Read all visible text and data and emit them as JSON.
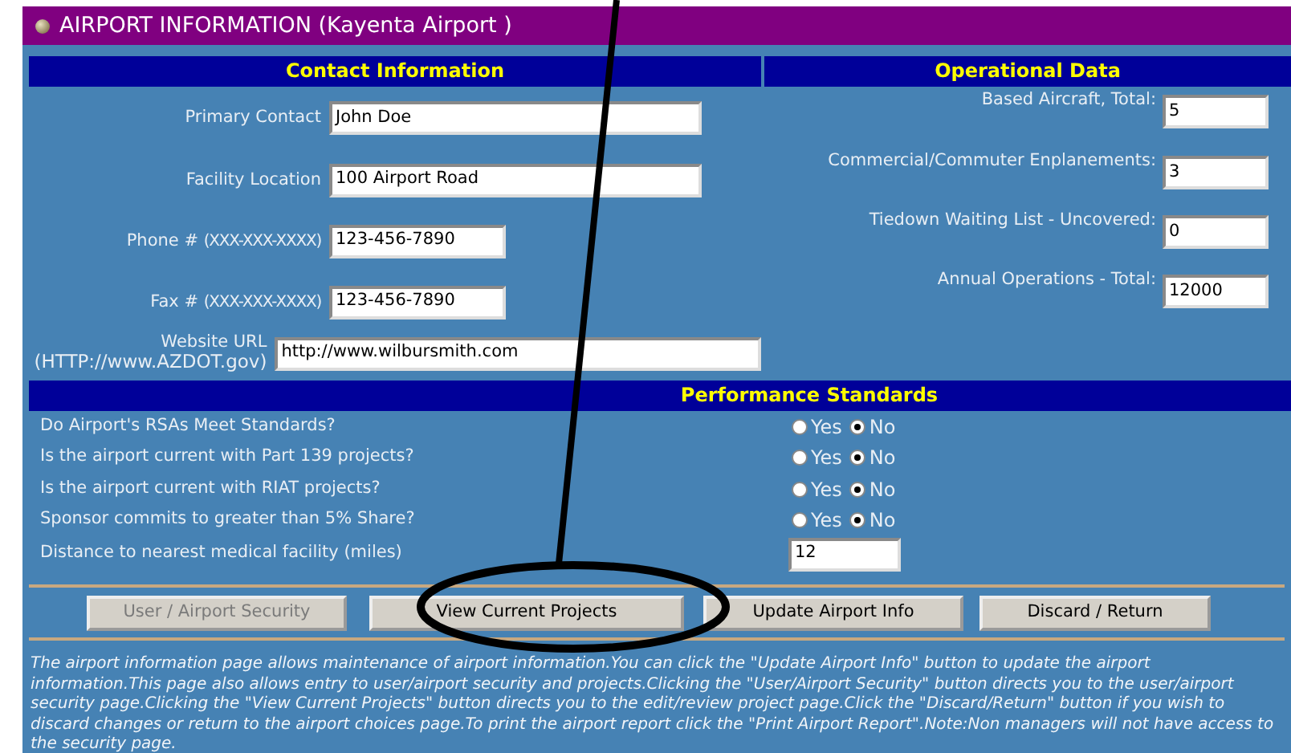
{
  "title": "AIRPORT INFORMATION (Kayenta Airport )",
  "contact": {
    "heading": "Contact Information",
    "fields": [
      {
        "label": "Primary Contact",
        "kind": "name",
        "value": "John Doe"
      },
      {
        "label": "Facility Location",
        "kind": "name",
        "value": "100 Airport Road"
      },
      {
        "label": "Phone #",
        "hint": "(XXX-XXX-XXXX)",
        "kind": "phone",
        "value": "123-456-7890"
      },
      {
        "label": "Fax #",
        "hint": "(XXX-XXX-XXXX)",
        "kind": "phone",
        "value": "123-456-7890"
      },
      {
        "label": "Website URL",
        "hint": "(HTTP://www.AZDOT.gov)",
        "kind": "url",
        "value": "http://www.wilbursmith.com"
      }
    ]
  },
  "operational": {
    "heading": "Operational Data",
    "fields": [
      {
        "label": "Based Aircraft, Total:",
        "value": "5"
      },
      {
        "label": "Commercial/Commuter Enplanements:",
        "value": "3"
      },
      {
        "label": "Tiedown Waiting List - Uncovered:",
        "value": "0"
      },
      {
        "label": "Annual Operations - Total:",
        "value": "12000"
      }
    ]
  },
  "performance": {
    "heading": "Performance Standards",
    "questions": [
      {
        "text": "Do Airport's RSAs Meet Standards?",
        "kind": "yesno",
        "options": [
          {
            "label": "Yes",
            "selected": false
          },
          {
            "label": "No",
            "selected": true
          }
        ]
      },
      {
        "text": "Is the airport current with Part 139 projects?",
        "kind": "yesno",
        "options": [
          {
            "label": "Yes",
            "selected": false
          },
          {
            "label": "No",
            "selected": true
          }
        ]
      },
      {
        "text": "Is the airport current with RIAT projects?",
        "kind": "yesno",
        "options": [
          {
            "label": "Yes",
            "selected": false
          },
          {
            "label": "No",
            "selected": true
          }
        ]
      },
      {
        "text": "Sponsor commits to greater than 5% Share?",
        "kind": "yesno",
        "options": [
          {
            "label": "Yes",
            "selected": false
          },
          {
            "label": "No",
            "selected": true
          }
        ]
      },
      {
        "text": "Distance to nearest medical facility (miles)",
        "kind": "number",
        "value": "12"
      }
    ]
  },
  "buttons": [
    {
      "label": "User / Airport Security",
      "disabled": true
    },
    {
      "label": "View Current Projects",
      "disabled": false
    },
    {
      "label": "Update Airport Info",
      "disabled": false
    },
    {
      "label": "Discard / Return",
      "disabled": false
    }
  ],
  "note": "The airport information page allows maintenance of airport information.You can click the \"Update Airport Info\" button to update the airport information.This page also allows entry to user/airport security and projects.Clicking the \"User/Airport Security\" button directs you to the user/airport security page.Clicking the \"View Current Projects\" button directs you to the edit/review project page.Click the \"Discard/Return\" button if you wish to discard changes or return to the airport choices page.To print the airport report click the \"Print Airport Report\".Note:Non managers will not have access to the security page."
}
